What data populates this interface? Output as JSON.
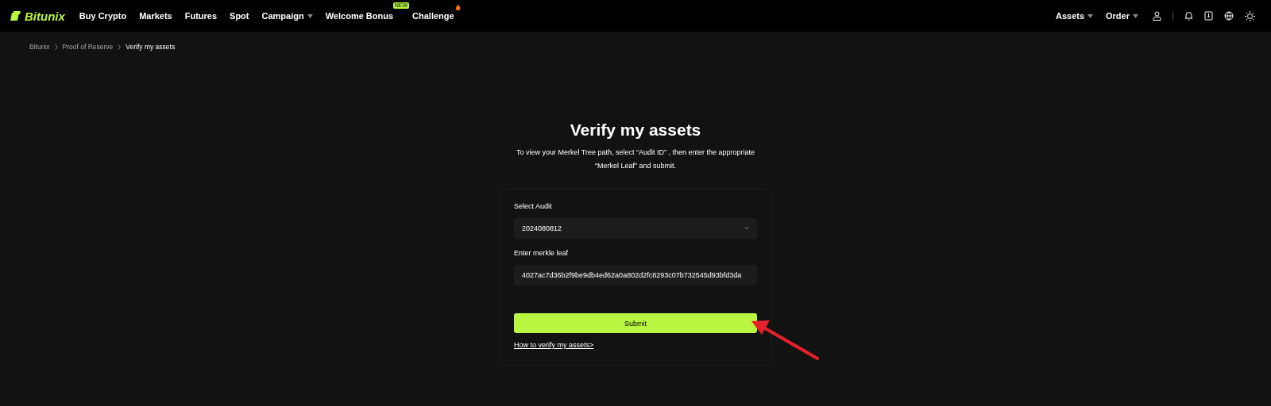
{
  "nav": {
    "logo": "Bitunix",
    "items": [
      {
        "label": "Buy Crypto",
        "dropdown": false,
        "kind": "plain"
      },
      {
        "label": "Markets",
        "dropdown": false,
        "kind": "plain"
      },
      {
        "label": "Futures",
        "dropdown": false,
        "kind": "plain"
      },
      {
        "label": "Spot",
        "dropdown": false,
        "kind": "plain"
      },
      {
        "label": "Campaign",
        "dropdown": true,
        "kind": "plain"
      },
      {
        "label": "Welcome Bonus",
        "dropdown": false,
        "kind": "new",
        "badge_text": "NEW"
      },
      {
        "label": "Challenge",
        "dropdown": false,
        "kind": "fire"
      }
    ],
    "right": [
      {
        "label": "Assets"
      },
      {
        "label": "Order"
      }
    ]
  },
  "breadcrumb": [
    {
      "label": "Bitunix",
      "selected": false
    },
    {
      "label": "Proof of Reserve",
      "selected": false
    },
    {
      "label": "Verify my assets",
      "selected": true
    }
  ],
  "title": "Verify my assets",
  "description": "To view your Merkel Tree path, select  “Audit ID” , then enter the appropriate  “Merkel Leaf”  and submit.",
  "form": {
    "select_label": "Select Audit",
    "select_value": "2024080812",
    "leaf_label": "Enter merkle leaf",
    "leaf_value": "4027ac7d36b2f9be9db4ed62a0a802d2fc8293c07b732545d93bfd3da",
    "submit": "Submit",
    "help_link": "How to verify my assets>"
  }
}
